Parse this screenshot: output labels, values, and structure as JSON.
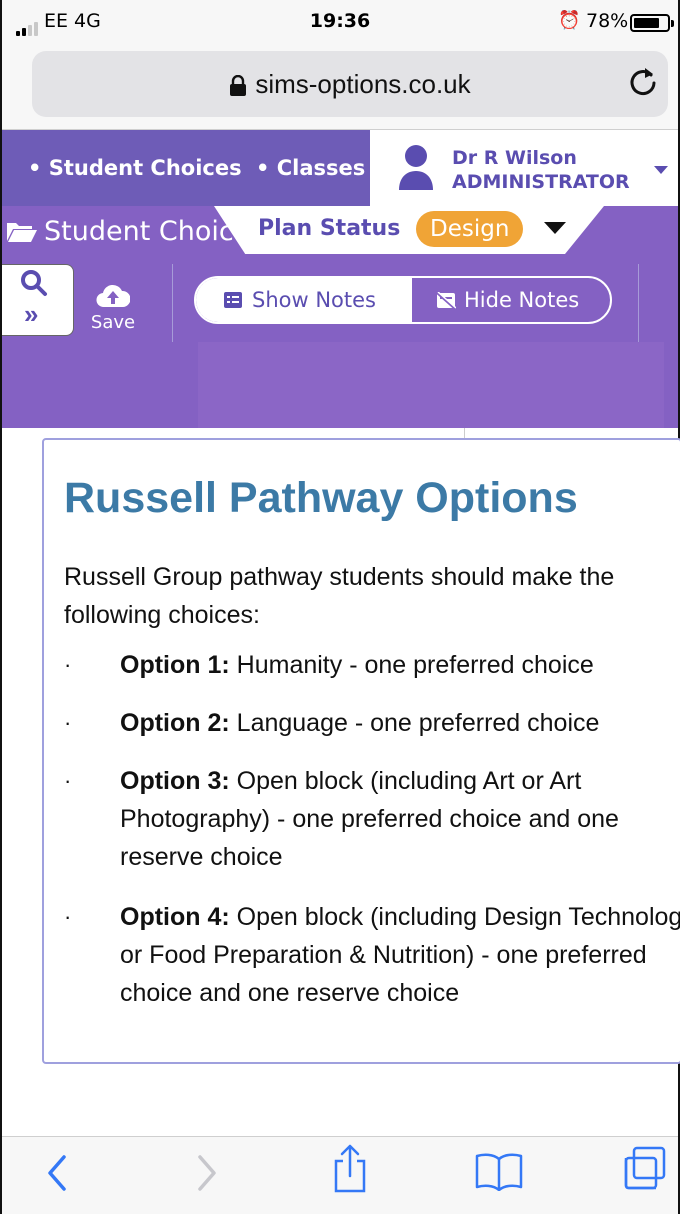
{
  "status_bar": {
    "carrier": "EE  4G",
    "time": "19:36",
    "battery_percent": "78%",
    "battery_level": 0.78,
    "icons": [
      "signal-icon",
      "alarm-icon",
      "battery-icon"
    ]
  },
  "browser": {
    "url": "sims-options.co.uk",
    "icons": [
      "lock-icon",
      "reload-icon"
    ]
  },
  "nav": {
    "links": [
      {
        "label": "• Student Choices"
      },
      {
        "label": "• Classes"
      }
    ],
    "user_name": "Dr R Wilson",
    "user_role": "ADMINISTRATOR"
  },
  "toolbar": {
    "breadcrumb": "Student Choices",
    "plan_status_label": "Plan Status",
    "plan_status_value": "Design",
    "save_label": "Save",
    "show_notes_label": "Show Notes",
    "hide_notes_label": "Hide Notes"
  },
  "card": {
    "title": "Russell Pathway Options",
    "intro": "Russell Group pathway students should make the following choices:",
    "options": [
      {
        "bullet": "·",
        "label": "Option 1:",
        "text": " Humanity - one preferred choice"
      },
      {
        "bullet": "·",
        "label": "Option 2:",
        "text": " Language - one preferred choice"
      },
      {
        "bullet": "·",
        "label": "Option 3:",
        "text": " Open block (including Art or Art Photography) - one preferred choice and one reserve choice"
      },
      {
        "bullet": "·",
        "label": "Option 4:",
        "text": " Open block (including Design Technology or Food Preparation & Nutrition) - one preferred choice and one reserve choice"
      }
    ]
  },
  "colors": {
    "nav_purple": "#6e5cb7",
    "sub_purple": "#8461c3",
    "badge_orange": "#f0a436",
    "title_blue": "#3c7aa6",
    "ios_blue": "#3478f6"
  }
}
